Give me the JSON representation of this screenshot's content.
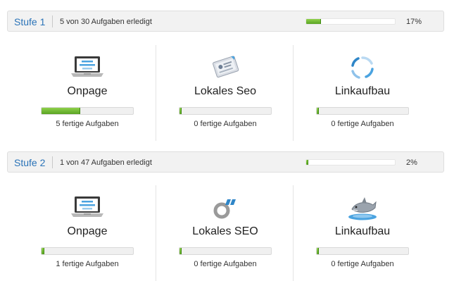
{
  "stages": [
    {
      "title": "Stufe 1",
      "summary": "5 von 30 Aufgaben erledigt",
      "progress_pct": 17,
      "progress_label": "17%",
      "categories": [
        {
          "icon": "laptop-icon",
          "title": "Onpage",
          "progress": 0.42,
          "count": "5 fertige Aufgaben"
        },
        {
          "icon": "business-card-icon",
          "title": "Lokales Seo",
          "progress": 0.0,
          "count": "0 fertige Aufgaben"
        },
        {
          "icon": "spinner-icon",
          "title": "Linkaufbau",
          "progress": 0.0,
          "count": "0 fertige Aufgaben"
        }
      ]
    },
    {
      "title": "Stufe 2",
      "summary": "1 von 47 Aufgaben erledigt",
      "progress_pct": 2,
      "progress_label": "2%",
      "categories": [
        {
          "icon": "laptop-icon",
          "title": "Onpage",
          "progress": 0.03,
          "count": "1 fertige Aufgaben"
        },
        {
          "icon": "quote-ring-icon",
          "title": "Lokales SEO",
          "progress": 0.0,
          "count": "0 fertige Aufgaben"
        },
        {
          "icon": "shark-icon",
          "title": "Linkaufbau",
          "progress": 0.0,
          "count": "0 fertige Aufgaben"
        }
      ]
    }
  ],
  "colors": {
    "accent": "#2a73b8",
    "progress_green": "#6dbb2f",
    "header_bg": "#f2f2f2"
  }
}
